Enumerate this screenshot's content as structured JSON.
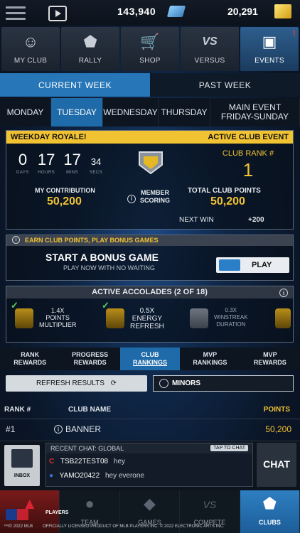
{
  "currency": {
    "stubs": "143,940",
    "coins": "20,291"
  },
  "main_nav": [
    {
      "label": "MY CLUB",
      "icon": "people-icon"
    },
    {
      "label": "RALLY",
      "icon": "home-plate-icon"
    },
    {
      "label": "SHOP",
      "icon": "cart-icon"
    },
    {
      "label": "VERSUS",
      "icon": "versus-icon"
    },
    {
      "label": "EVENTS",
      "icon": "events-icon",
      "alert": "!"
    }
  ],
  "week_tabs": [
    "CURRENT WEEK",
    "PAST WEEK"
  ],
  "day_tabs": [
    "MONDAY",
    "TUESDAY",
    "WEDNESDAY",
    "THURSDAY",
    "MAIN EVENT",
    "FRIDAY-SUNDAY"
  ],
  "event": {
    "name": "WEEKDAY ROYALE!",
    "tag": "ACTIVE CLUB EVENT",
    "timer": {
      "days": "0",
      "hours": "17",
      "mins": "17",
      "secs": "34",
      "days_lbl": "DAYS",
      "hours_lbl": "HOURS",
      "mins_lbl": "MINS",
      "secs_lbl": "SECS"
    },
    "rank_label": "CLUB RANK #",
    "rank": "1",
    "contribution_label": "MY CONTRIBUTION",
    "contribution": "50,200",
    "member_scoring_1": "MEMBER",
    "member_scoring_2": "SCORING",
    "total_label": "TOTAL CLUB POINTS",
    "total": "50,200",
    "next_win_label": "NEXT WIN",
    "next_win": "+200"
  },
  "bonus": {
    "header": "EARN CLUB POINTS, PLAY BONUS GAMES",
    "title": "START A BONUS GAME",
    "subtitle": "PLAY NOW WITH NO WAITING",
    "play": "PLAY"
  },
  "accolades": {
    "header": "ACTIVE ACCOLADES (2 OF 18)",
    "items": [
      {
        "l1": "1.4X",
        "l2": "POINTS",
        "l3": "MULTIPLIER"
      },
      {
        "l1": "0.5X",
        "l2": "ENERGY",
        "l3": "REFRESH"
      },
      {
        "l1": "0.3X",
        "l2": "WINSTREAK",
        "l3": "DURATION"
      }
    ]
  },
  "rank_tabs": [
    {
      "l1": "RANK",
      "l2": "REWARDS"
    },
    {
      "l1": "PROGRESS",
      "l2": "REWARDS"
    },
    {
      "l1": "CLUB",
      "l2": "RANKINGS"
    },
    {
      "l1": "MVP",
      "l2": "RANKINGS"
    },
    {
      "l1": "MVP",
      "l2": "REWARDS"
    }
  ],
  "refresh_label": "REFRESH RESULTS",
  "league_label": "MINORS",
  "table": {
    "headers": {
      "rank": "RANK #",
      "name": "CLUB NAME",
      "points": "POINTS"
    },
    "rows": [
      {
        "rank": "#1",
        "name": "BANNER",
        "points": "50,200"
      }
    ]
  },
  "chat": {
    "inbox": "INBOX",
    "header": "RECENT CHAT: GLOBAL",
    "tap": "TAP TO CHAT",
    "messages": [
      {
        "user": "TSB22TEST08",
        "text": "hey"
      },
      {
        "user": "YAMO20422",
        "text": "hey everone"
      }
    ],
    "button": "CHAT"
  },
  "bottom_nav": [
    {
      "label": "",
      "icon": "home-icon"
    },
    {
      "label": "TEAM",
      "icon": "team-icon"
    },
    {
      "label": "GAMES",
      "icon": "games-icon"
    },
    {
      "label": "COMPETE",
      "icon": "compete-icon"
    },
    {
      "label": "CLUBS",
      "icon": "clubs-icon"
    }
  ],
  "legal": {
    "left": "™/© 2022 MLB",
    "center": "OFFICIALLY LICENSED PRODUCT OF MLB PLAYERS INC. © 2022 ELECTRONIC ARTS INC.",
    "players": "PLAYERS"
  }
}
